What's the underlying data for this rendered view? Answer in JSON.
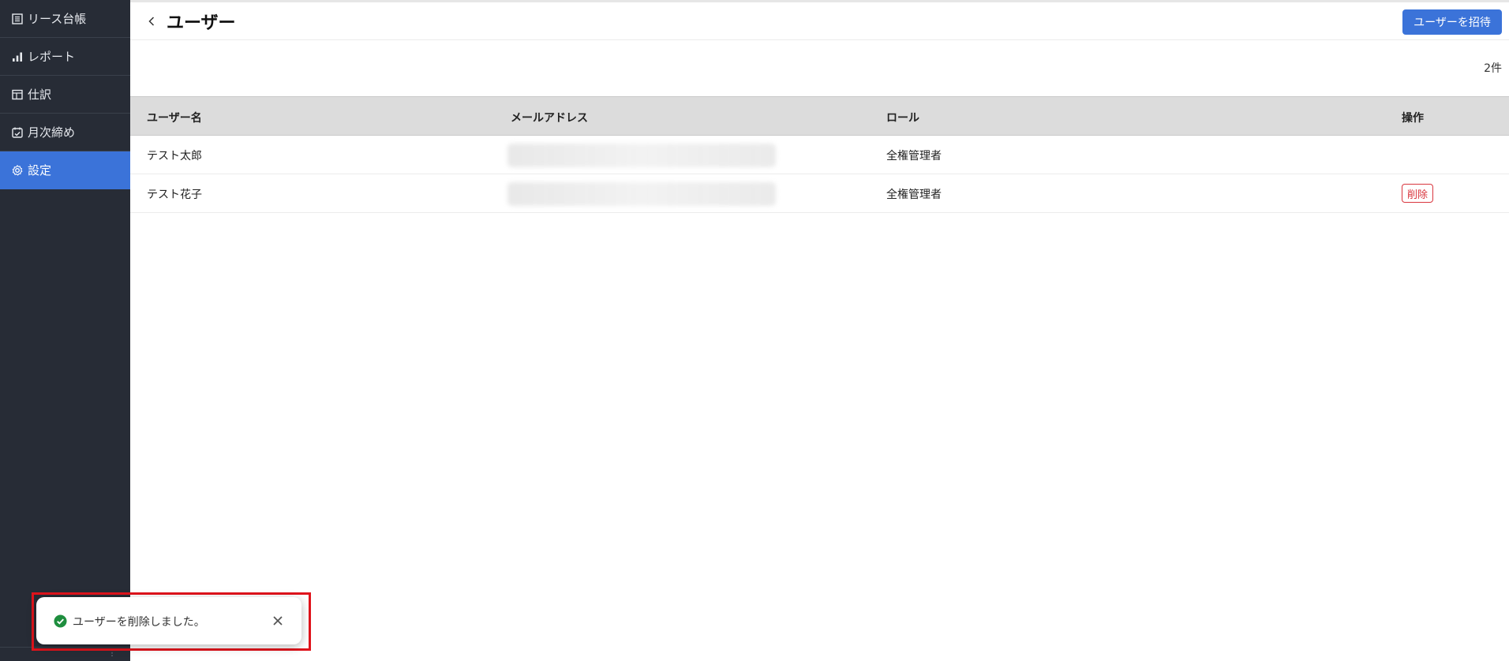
{
  "sidebar": {
    "items": [
      {
        "label": "リース台帳",
        "icon": "ledger-icon"
      },
      {
        "label": "レポート",
        "icon": "bar-chart-icon"
      },
      {
        "label": "仕訳",
        "icon": "journal-table-icon"
      },
      {
        "label": "月次締め",
        "icon": "calendar-check-icon"
      },
      {
        "label": "設定",
        "icon": "gear-icon"
      }
    ],
    "active_index": 4
  },
  "header": {
    "title": "ユーザー",
    "invite_button": "ユーザーを招待"
  },
  "count_label": "2件",
  "table": {
    "columns": [
      "ユーザー名",
      "メールアドレス",
      "ロール",
      "操作"
    ],
    "rows": [
      {
        "name": "テスト太郎",
        "email": "",
        "role": "全権管理者",
        "action": ""
      },
      {
        "name": "テスト花子",
        "email": "",
        "role": "全権管理者",
        "action": "削除"
      }
    ]
  },
  "toast": {
    "message": "ユーザーを削除しました。",
    "icon": "success-check-icon"
  },
  "colors": {
    "sidebar_bg": "#272c36",
    "accent": "#3b73d9",
    "danger": "#d9363e",
    "success": "#1e8e3e",
    "highlight_frame": "#e0141c"
  }
}
